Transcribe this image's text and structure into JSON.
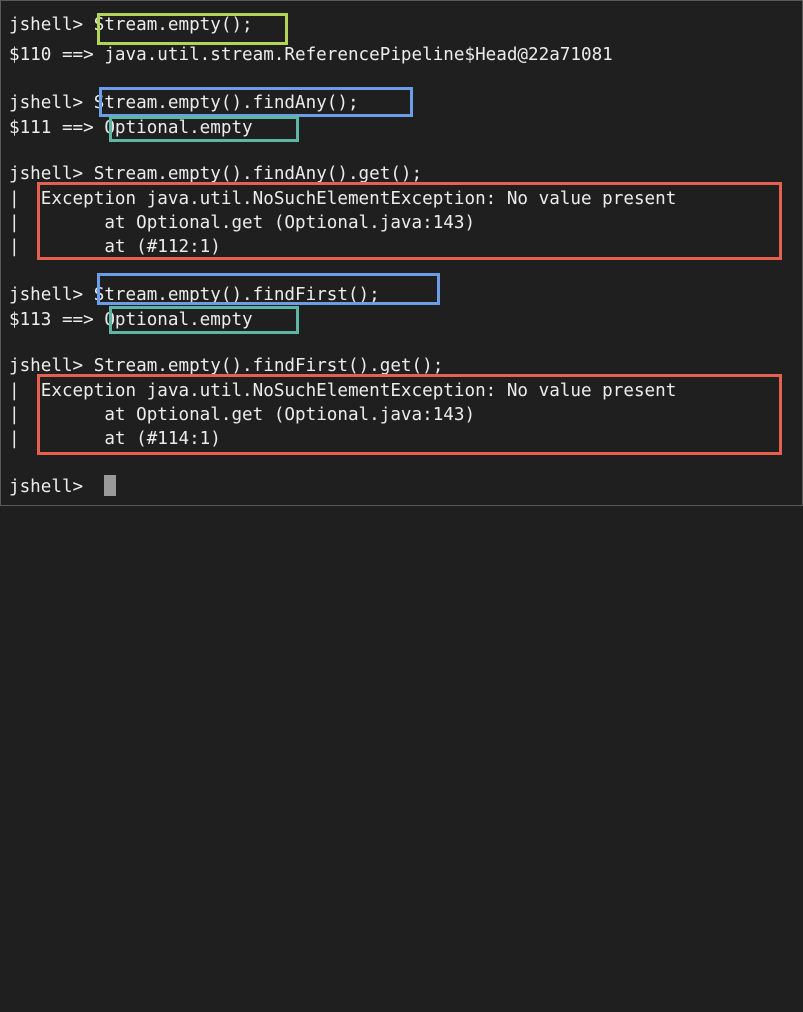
{
  "terminal": {
    "lines": [
      {
        "prompt": "jshell> ",
        "text": "Stream.empty();"
      },
      {
        "prompt": "",
        "text": "$110 ==> java.util.stream.ReferencePipeline$Head@22a71081"
      },
      {
        "prompt": "jshell> ",
        "text": "Stream.empty().findAny();"
      },
      {
        "prompt": "$111 ==> ",
        "text": "Optional.empty"
      },
      {
        "prompt": "jshell> ",
        "text": "Stream.empty().findAny().get();"
      },
      {
        "prompt": "|  ",
        "text": "Exception java.util.NoSuchElementException: No value present"
      },
      {
        "prompt": "|        ",
        "text": "at Optional.get (Optional.java:143)"
      },
      {
        "prompt": "|        ",
        "text": "at (#112:1)"
      },
      {
        "prompt": "jshell> ",
        "text": "Stream.empty().findFirst();"
      },
      {
        "prompt": "$113 ==> ",
        "text": "Optional.empty"
      },
      {
        "prompt": "jshell> ",
        "text": "Stream.empty().findFirst().get();"
      },
      {
        "prompt": "|  ",
        "text": "Exception java.util.NoSuchElementException: No value present"
      },
      {
        "prompt": "|        ",
        "text": "at Optional.get (Optional.java:143)"
      },
      {
        "prompt": "|        ",
        "text": "at (#114:1)"
      },
      {
        "prompt": "jshell> ",
        "text": ""
      }
    ]
  },
  "colors": {
    "background": "#1f1f1f",
    "text": "#ececec",
    "highlight_green": "#b2d458",
    "highlight_blue": "#6c9ee8",
    "highlight_teal": "#5cb6a3",
    "highlight_red": "#e5604f"
  }
}
